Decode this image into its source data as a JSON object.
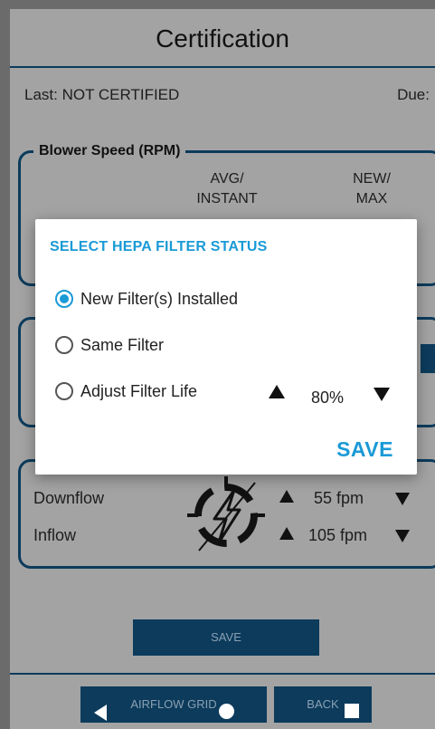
{
  "header": {
    "title": "Certification"
  },
  "status": {
    "last": "Last: NOT CERTIFIED",
    "due": "Due:"
  },
  "blower": {
    "legend": "Blower Speed (RPM)",
    "col_avg": "AVG/\nINSTANT",
    "col_new": "NEW/\nMAX"
  },
  "airflow": {
    "rows": [
      {
        "label": "Downflow",
        "value": "55 fpm"
      },
      {
        "label": "Inflow",
        "value": "105 fpm"
      }
    ]
  },
  "buttons": {
    "save": "SAVE",
    "airflow_grid": "AIRFLOW GRID",
    "back": "BACK"
  },
  "dialog": {
    "title": "SELECT HEPA FILTER STATUS",
    "options": [
      {
        "label": "New Filter(s) Installed",
        "selected": true
      },
      {
        "label": "Same Filter",
        "selected": false
      },
      {
        "label": "Adjust Filter Life",
        "selected": false
      }
    ],
    "filter_life": "80%",
    "save": "SAVE"
  },
  "colors": {
    "accent": "#1a9ad6",
    "primary_dark": "#0c3b5c",
    "dim_overlay": "#a3a3a3"
  },
  "icons": [
    "lightning-gauge-icon",
    "increase-icon",
    "decrease-icon",
    "nav-back-icon",
    "nav-home-icon",
    "nav-recents-icon"
  ]
}
